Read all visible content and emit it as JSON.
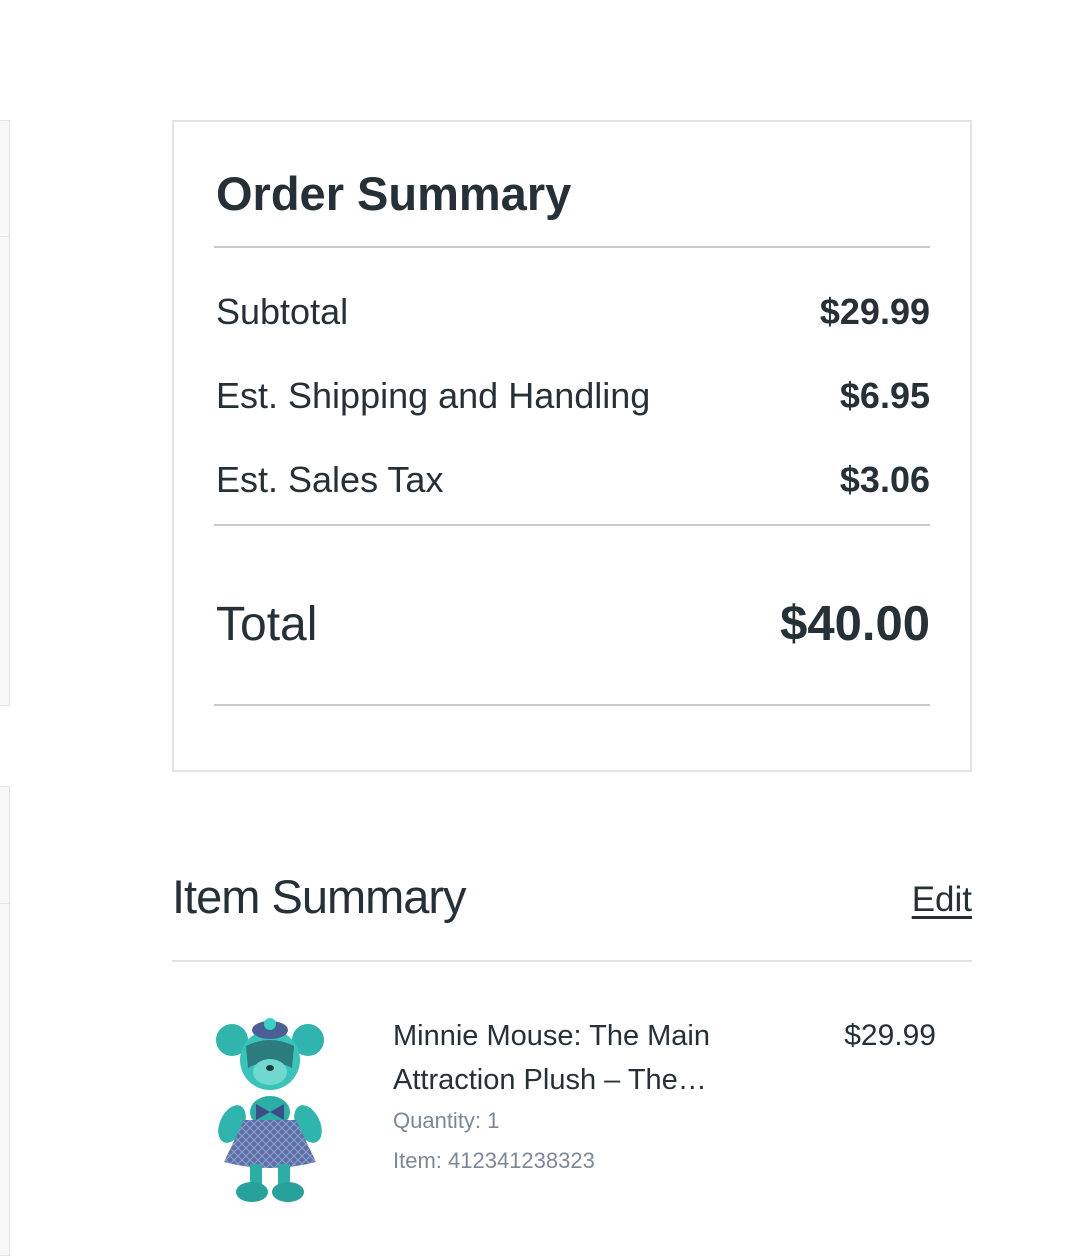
{
  "order_summary": {
    "title": "Order Summary",
    "lines": [
      {
        "label": "Subtotal",
        "amount": "$29.99"
      },
      {
        "label": "Est. Shipping and Handling",
        "amount": "$6.95"
      },
      {
        "label": "Est. Sales Tax",
        "amount": "$3.06"
      }
    ],
    "total": {
      "label": "Total",
      "amount": "$40.00"
    }
  },
  "item_summary": {
    "title": "Item Summary",
    "edit_label": "Edit",
    "items": [
      {
        "name": "Minnie Mouse: The Main Attraction Plush – The…",
        "price": "$29.99",
        "quantity": "Quantity: 1",
        "item_number": "Item: 412341238323",
        "image_icon": "minnie-mouse-plush-image"
      }
    ]
  },
  "colors": {
    "text": "#253037",
    "muted": "#7b8995",
    "border": "#e4e4e4",
    "plush_teal": "#3fc1b8",
    "plush_dress": "#5b6fa8"
  }
}
